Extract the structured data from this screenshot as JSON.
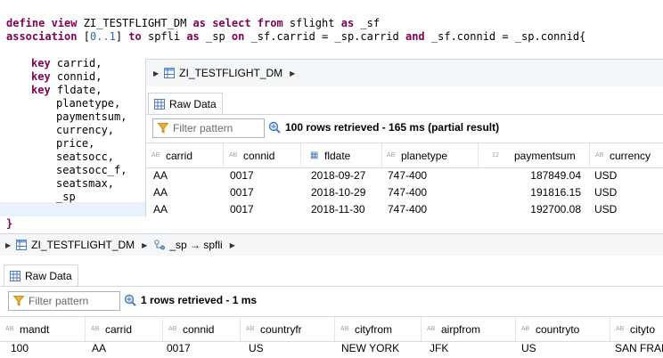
{
  "code": {
    "line1": {
      "k1": "define view",
      "t1": " ZI_TESTFLIGHT_DM ",
      "k2": "as select from",
      "t2": " sflight ",
      "k3": "as",
      "t3": " _sf"
    },
    "line2": {
      "k1": "association",
      "t1": " [",
      "n1": "0..1",
      "t2": "] ",
      "k2": "to",
      "t3": " spfli ",
      "k3": "as",
      "t4": " _sp ",
      "k4": "on",
      "t5": " _sf.carrid = _sp.carrid ",
      "k5": "and",
      "t6": " _sf.connid = _sp.connid{"
    },
    "key_word": "key",
    "keys": [
      "carrid,",
      "connid,",
      "fldate,"
    ],
    "fields": [
      "planetype,",
      "paymentsum,",
      "currency,",
      "price,",
      "seatsocc,",
      "seatsocc_f,",
      "seatsmax,",
      "_sp"
    ],
    "closing": "}"
  },
  "top_panel": {
    "breadcrumb": "ZI_TESTFLIGHT_DM",
    "tab": "Raw Data",
    "filter_placeholder": "Filter pattern",
    "status": "100 rows retrieved - 165 ms (partial result)",
    "columns": [
      {
        "type": "AB",
        "name": "carrid"
      },
      {
        "type": "AB",
        "name": "connid"
      },
      {
        "type": "CAL",
        "name": "fldate"
      },
      {
        "type": "AB",
        "name": "planetype"
      },
      {
        "type": "12",
        "name": "paymentsum"
      },
      {
        "type": "AB",
        "name": "currency"
      }
    ],
    "rows": [
      [
        "AA",
        "0017",
        "2018-09-27",
        "747-400",
        "187849.04",
        "USD"
      ],
      [
        "AA",
        "0017",
        "2018-10-29",
        "747-400",
        "191816.15",
        "USD"
      ],
      [
        "AA",
        "0017",
        "2018-11-30",
        "747-400",
        "192700.08",
        "USD"
      ]
    ]
  },
  "bottom_panel": {
    "breadcrumb1": "ZI_TESTFLIGHT_DM",
    "breadcrumb2": "_sp → spfli",
    "tab": "Raw Data",
    "filter_placeholder": "Filter pattern",
    "status": "1 rows retrieved - 1 ms",
    "columns": [
      {
        "type": "AB",
        "name": "mandt"
      },
      {
        "type": "AB",
        "name": "carrid"
      },
      {
        "type": "AB",
        "name": "connid"
      },
      {
        "type": "AB",
        "name": "countryfr"
      },
      {
        "type": "AB",
        "name": "cityfrom"
      },
      {
        "type": "AB",
        "name": "airpfrom"
      },
      {
        "type": "AB",
        "name": "countryto"
      },
      {
        "type": "AB",
        "name": "cityto"
      }
    ],
    "rows": [
      [
        "100",
        "AA",
        "0017",
        "US",
        "NEW YORK",
        "JFK",
        "US",
        "SAN FRANCISCO"
      ]
    ]
  }
}
